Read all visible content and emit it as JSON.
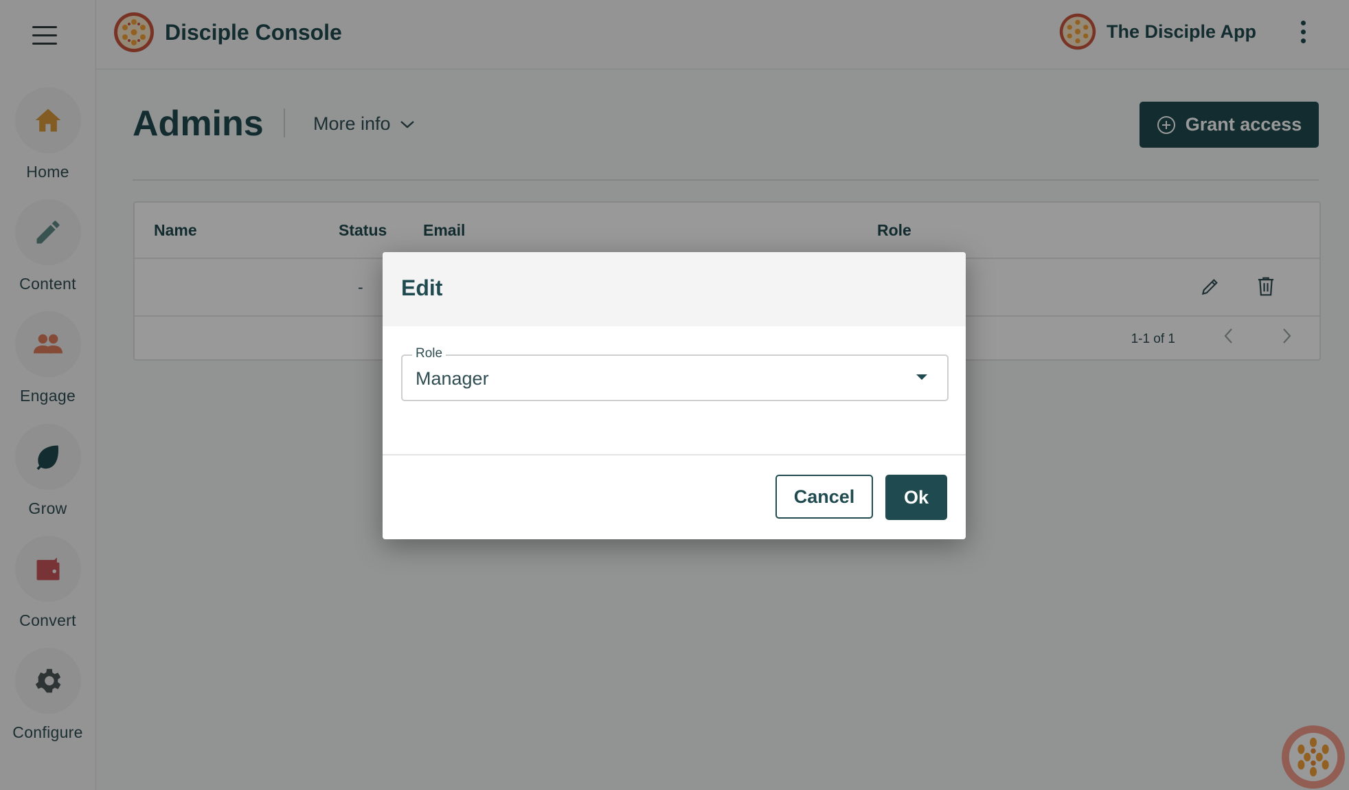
{
  "brand": {
    "title": "Disciple Console",
    "app_name": "The Disciple App"
  },
  "sidebar": {
    "items": [
      {
        "label": "Home",
        "icon": "home-icon",
        "color": "#d99a3a"
      },
      {
        "label": "Content",
        "icon": "pencil-icon",
        "color": "#5e8a86"
      },
      {
        "label": "Engage",
        "icon": "people-icon",
        "color": "#e07d5c"
      },
      {
        "label": "Grow",
        "icon": "leaf-icon",
        "color": "#1f4a4f"
      },
      {
        "label": "Convert",
        "icon": "wallet-icon",
        "color": "#c8555c"
      },
      {
        "label": "Configure",
        "icon": "gear-icon",
        "color": "#4e5557"
      }
    ]
  },
  "page": {
    "title": "Admins",
    "more_info": "More info",
    "grant_access": "Grant access"
  },
  "table": {
    "columns": [
      "Name",
      "Status",
      "Email",
      "Role"
    ],
    "rows": [
      {
        "name": "",
        "status": "-",
        "email": "",
        "role": ""
      }
    ],
    "pagination": "1-1 of 1"
  },
  "dialog": {
    "title": "Edit",
    "role_label": "Role",
    "role_value": "Manager",
    "cancel": "Cancel",
    "ok": "Ok"
  },
  "colors": {
    "primary": "#1f4a4f",
    "logo_ring": "#c8553d",
    "logo_fill": "#f4a23a"
  }
}
